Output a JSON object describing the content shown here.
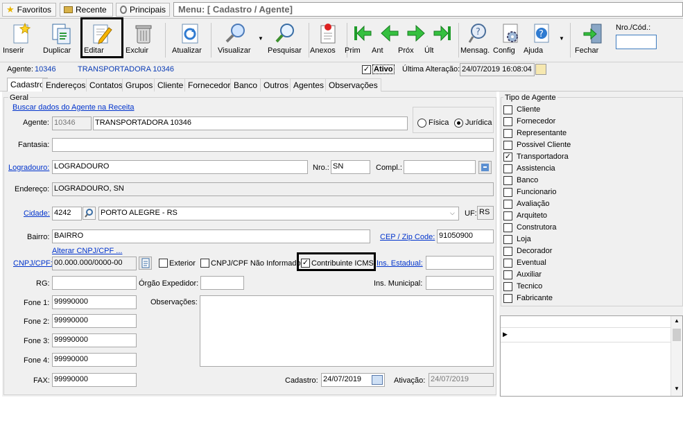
{
  "topbar": {
    "favoritos": "Favoritos",
    "recente": "Recente",
    "principais": "Principais",
    "menu_path": "Menu: [ Cadastro / Agente]"
  },
  "toolbar": {
    "inserir": "Inserir",
    "duplicar": "Duplicar",
    "editar": "Editar",
    "excluir": "Excluir",
    "atualizar": "Atualizar",
    "visualizar": "Visualizar",
    "pesquisar": "Pesquisar",
    "anexos": "Anexos",
    "prim": "Prim",
    "ant": "Ant",
    "prox": "Próx",
    "ult": "Últ",
    "mensag": "Mensag.",
    "config": "Config",
    "ajuda": "Ajuda",
    "fechar": "Fechar",
    "nro_label": "Nro./Cód.:",
    "nro_value": ""
  },
  "infobar": {
    "agente_label": "Agente:",
    "agente_code": "10346",
    "agente_name": "TRANSPORTADORA 10346",
    "ativo_label": "Ativo",
    "ativo_checked": "✓",
    "ultima_label": "Última Alteração:",
    "ultima_value": "24/07/2019 16:08:04"
  },
  "tabs": [
    "Cadastro",
    "Endereços",
    "Contatos",
    "Grupos",
    "Cliente",
    "Fornecedor",
    "Banco",
    "Outros",
    "Agentes",
    "Observações"
  ],
  "form": {
    "geral": "Geral",
    "buscar_link": "Buscar dados do Agente na Receita",
    "agente_label": "Agente:",
    "agente_code": "10346",
    "agente_name": "TRANSPORTADORA 10346",
    "fisica": "Física",
    "juridica": "Jurídica",
    "fantasia_label": "Fantasia:",
    "fantasia": "",
    "logradouro_label": "Logradouro:",
    "logradouro": "LOGRADOURO",
    "nro_label": "Nro.:",
    "nro": "SN",
    "compl_label": "Compl.:",
    "compl": "",
    "endereco_label": "Endereço:",
    "endereco": "LOGRADOURO, SN",
    "cidade_label": "Cidade:",
    "cidade_code": "4242",
    "cidade": "PORTO ALEGRE - RS",
    "uf_label": "UF:",
    "uf": "RS",
    "bairro_label": "Bairro:",
    "bairro": "BAIRRO",
    "cep_label": "CEP / Zip Code:",
    "cep": "91050900",
    "alterar_link": "Alterar CNPJ/CPF ...",
    "cnpj_label": "CNPJ/CPF:",
    "cnpj": "00.000.000/0000-00",
    "exterior": "Exterior",
    "nao_informado": "CNPJ/CPF Não Informado",
    "contribuinte": "Contribuinte ICMS",
    "contribuinte_checked": "✓",
    "ins_estadual_label": "Ins. Estadual:",
    "ins_estadual": "",
    "rg_label": "RG:",
    "rg": "",
    "orgao_label": "Órgão Expedidor:",
    "orgao": "",
    "ins_municipal_label": "Ins. Municipal:",
    "ins_municipal": "",
    "fone1_label": "Fone 1:",
    "fone1": "99990000",
    "fone2_label": "Fone 2:",
    "fone2": "99990000",
    "fone3_label": "Fone 3:",
    "fone3": "99990000",
    "fone4_label": "Fone 4:",
    "fone4": "99990000",
    "fax_label": "FAX:",
    "fax": "99990000",
    "obs_label": "Observações:",
    "obs": "",
    "cadastro_label": "Cadastro:",
    "cadastro": "24/07/2019",
    "ativacao_label": "Ativação:",
    "ativacao": "24/07/2019"
  },
  "tipo_agente": {
    "title": "Tipo de Agente",
    "items": [
      {
        "label": "Cliente",
        "mark": ""
      },
      {
        "label": "Fornecedor",
        "mark": ""
      },
      {
        "label": "Representante",
        "mark": ""
      },
      {
        "label": "Possivel Cliente",
        "mark": ""
      },
      {
        "label": "Transportadora",
        "mark": "✓"
      },
      {
        "label": "Assistencia",
        "mark": ""
      },
      {
        "label": "Banco",
        "mark": ""
      },
      {
        "label": "Funcionario",
        "mark": ""
      },
      {
        "label": "Avaliação",
        "mark": ""
      },
      {
        "label": "Arquiteto",
        "mark": ""
      },
      {
        "label": "Construtora",
        "mark": ""
      },
      {
        "label": "Loja",
        "mark": ""
      },
      {
        "label": "Decorador",
        "mark": ""
      },
      {
        "label": "Eventual",
        "mark": ""
      },
      {
        "label": "Auxiliar",
        "mark": ""
      },
      {
        "label": "Tecnico",
        "mark": ""
      },
      {
        "label": "Fabricante",
        "mark": ""
      }
    ]
  },
  "grid": {
    "row_indicator": "▶",
    "scroll_up": "▲",
    "scroll_down": "▼"
  }
}
